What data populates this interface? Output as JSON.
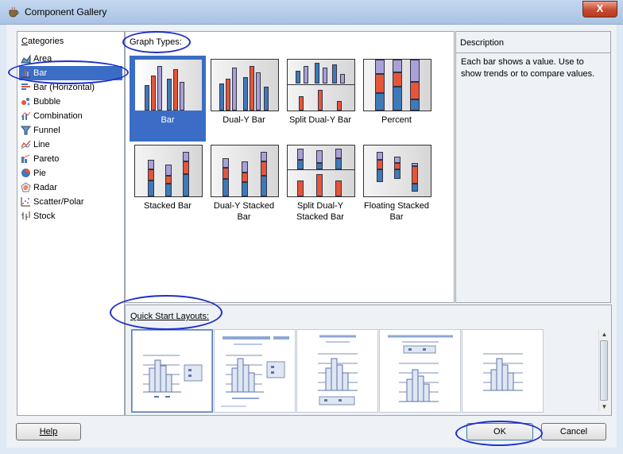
{
  "window": {
    "title": "Component Gallery",
    "close_label": "X"
  },
  "categories": {
    "header": "Categories",
    "header_underline": "C",
    "items": [
      {
        "label": "Area",
        "icon": "area-chart-icon"
      },
      {
        "label": "Bar",
        "icon": "bar-chart-icon",
        "selected": true
      },
      {
        "label": "Bar (Horizontal)",
        "icon": "horizontal-bar-chart-icon"
      },
      {
        "label": "Bubble",
        "icon": "bubble-chart-icon"
      },
      {
        "label": "Combination",
        "icon": "combination-chart-icon"
      },
      {
        "label": "Funnel",
        "icon": "funnel-chart-icon"
      },
      {
        "label": "Line",
        "icon": "line-chart-icon"
      },
      {
        "label": "Pareto",
        "icon": "pareto-chart-icon"
      },
      {
        "label": "Pie",
        "icon": "pie-chart-icon"
      },
      {
        "label": "Radar",
        "icon": "radar-chart-icon"
      },
      {
        "label": "Scatter/Polar",
        "icon": "scatter-chart-icon"
      },
      {
        "label": "Stock",
        "icon": "stock-chart-icon"
      }
    ]
  },
  "graph_types": {
    "header": "Graph Types:",
    "items": [
      {
        "label": "Bar",
        "selected": true
      },
      {
        "label": "Dual-Y Bar"
      },
      {
        "label": "Split Dual-Y Bar"
      },
      {
        "label": "Percent"
      },
      {
        "label": "Stacked Bar"
      },
      {
        "label": "Dual-Y Stacked Bar"
      },
      {
        "label": "Split Dual-Y Stacked Bar"
      },
      {
        "label": "Floating Stacked Bar"
      }
    ]
  },
  "description": {
    "header": "Description",
    "text": "Each bar shows a value. Use to show trends or to compare values."
  },
  "quick_start": {
    "header": "Quick Start Layouts:",
    "tile_count_visible": 5,
    "selected_index": 0
  },
  "buttons": {
    "help": "Help",
    "ok": "OK",
    "cancel": "Cancel"
  },
  "colors": {
    "selection": "#3b6dc6",
    "annotation": "#1f2fc9",
    "bar_blue": "#3f79b8",
    "bar_red": "#e5553a",
    "bar_purple": "#a8a0d6"
  }
}
